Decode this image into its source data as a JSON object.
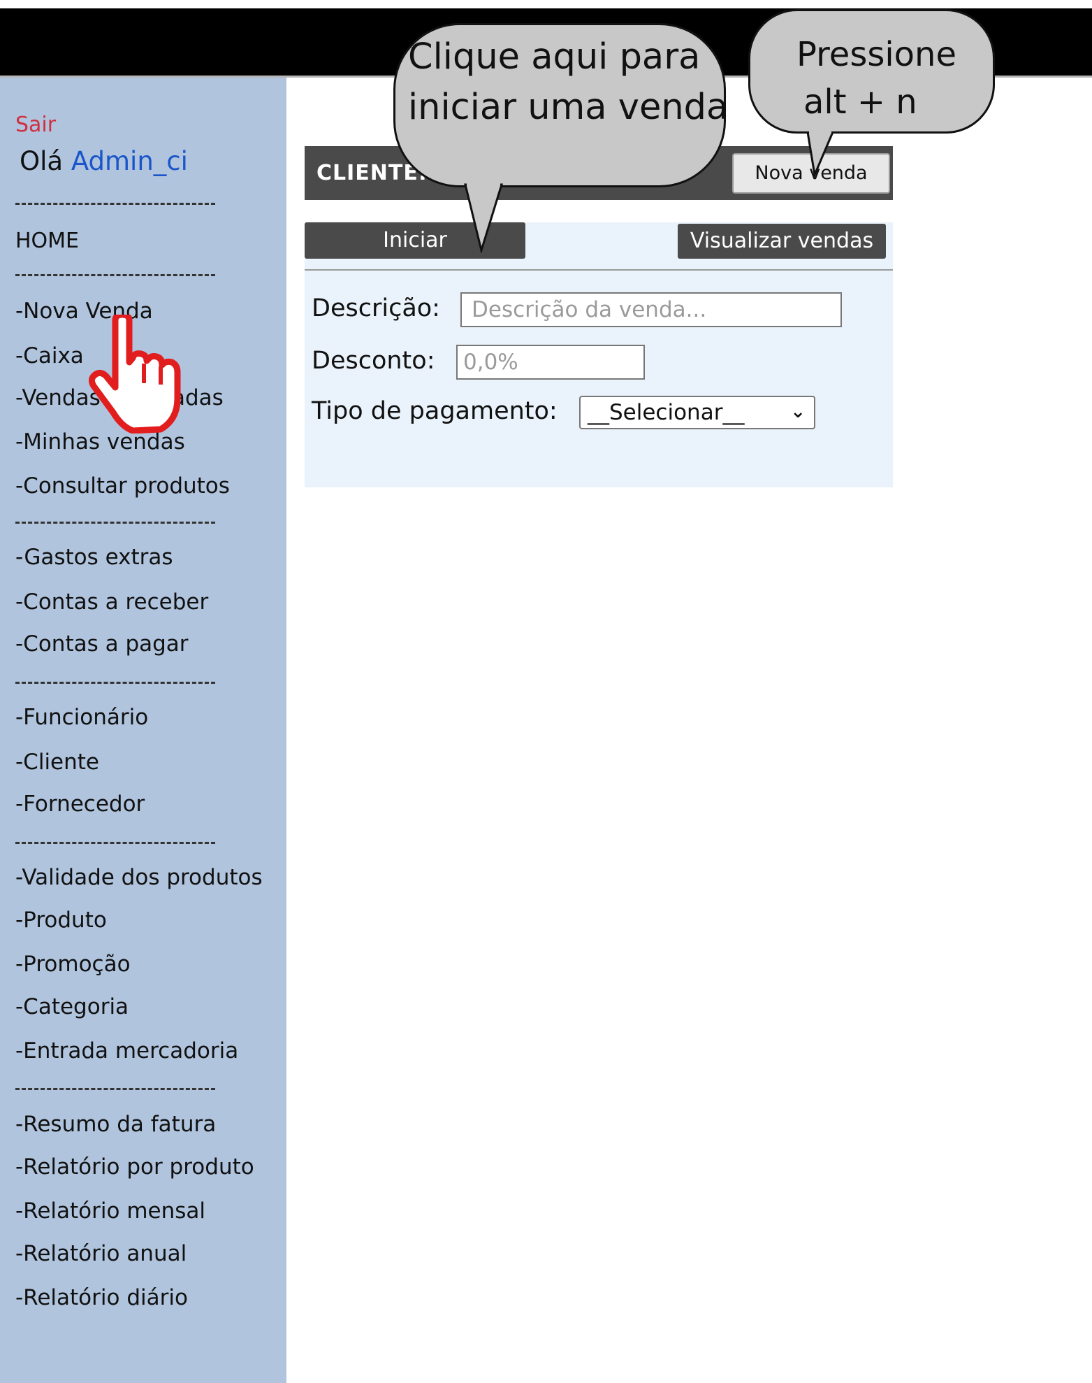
{
  "sidebar": {
    "logout": "Sair",
    "greeting": "Olá",
    "username": "Admin_ci",
    "home": "HOME",
    "items": [
      "-Nova Venda",
      "-Caixa",
      "-Vendas",
      "adas",
      "-Minhas vendas",
      "-Consultar produtos",
      "-Gastos extras",
      "-Contas a receber",
      "-Contas a pagar",
      "-Funcionário",
      "-Cliente",
      "-Fornecedor",
      "-Validade dos produtos",
      "-Produto",
      "-Promoção",
      "-Categoria",
      "-Entrada mercadoria",
      "-Resumo da fatura",
      "-Relatório por produto",
      "-Relatório mensal",
      "-Relatório anual",
      "-Relatório diário"
    ]
  },
  "header": {
    "client_label": "CLIENTE:",
    "new_sale_button": "Nova venda"
  },
  "actions": {
    "start_button": "Iniciar",
    "view_sales_button": "Visualizar vendas"
  },
  "form": {
    "description_label": "Descrição:",
    "description_placeholder": "Descrição da venda...",
    "discount_label": "Desconto:",
    "discount_placeholder": "0,0%",
    "payment_label": "Tipo de pagamento:",
    "payment_selected": "__Selecionar__"
  },
  "callouts": {
    "start_hint_line1": "Clique aqui para",
    "start_hint_line2": "iniciar uma venda",
    "shortcut_hint_line1": "Pressione",
    "shortcut_hint_line2": "alt  +  n"
  },
  "colors": {
    "sidebar_bg": "#b0c4de",
    "logout": "#d03040",
    "username": "#1a56c9",
    "dark_button": "#4a4a4a",
    "form_bg": "#eaf3fb",
    "pointer_hand": "#e21d1d"
  },
  "icons": {
    "pointer": "hand-pointer-icon",
    "dropdown": "chevron-down-icon"
  }
}
